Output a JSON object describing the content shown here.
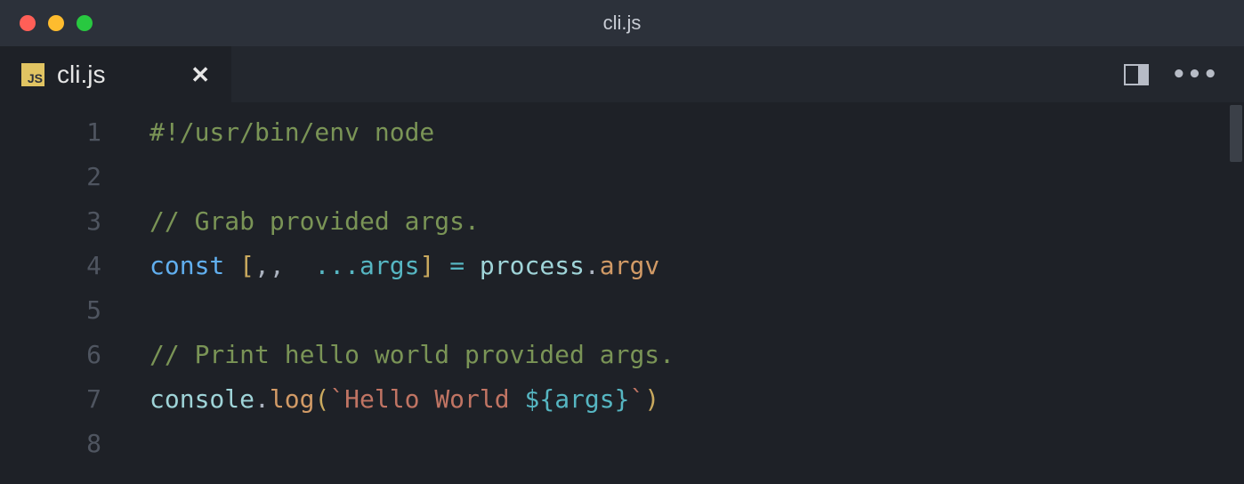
{
  "window": {
    "title": "cli.js"
  },
  "tabs": [
    {
      "icon": "js",
      "label": "cli.js",
      "dirty": false,
      "active": true
    }
  ],
  "editor": {
    "language": "javascript",
    "filename": "cli.js",
    "line_numbers": [
      "1",
      "2",
      "3",
      "4",
      "5",
      "6",
      "7",
      "8"
    ],
    "lines_plain": [
      "#!/usr/bin/env node",
      "",
      "// Grab provided args.",
      "const [,,  ...args] = process.argv",
      "",
      "// Print hello world provided args.",
      "console.log(`Hello World ${args}`)",
      ""
    ],
    "tokens": [
      [
        {
          "t": "#!/usr/bin/env node",
          "c": "tok-comment"
        }
      ],
      [
        {
          "t": " ",
          "c": "tok-ident"
        }
      ],
      [
        {
          "t": "// Grab provided args.",
          "c": "tok-comment"
        }
      ],
      [
        {
          "t": "const ",
          "c": "tok-keyword"
        },
        {
          "t": "[",
          "c": "tok-paren"
        },
        {
          "t": ",,  ",
          "c": "tok-punct"
        },
        {
          "t": "...",
          "c": "tok-op"
        },
        {
          "t": "args",
          "c": "tok-var"
        },
        {
          "t": "]",
          "c": "tok-paren"
        },
        {
          "t": " ",
          "c": "tok-punct"
        },
        {
          "t": "=",
          "c": "tok-op"
        },
        {
          "t": " ",
          "c": "tok-punct"
        },
        {
          "t": "process",
          "c": "tok-obj"
        },
        {
          "t": ".",
          "c": "tok-punct"
        },
        {
          "t": "argv",
          "c": "tok-prop"
        }
      ],
      [
        {
          "t": " ",
          "c": "tok-ident"
        }
      ],
      [
        {
          "t": "// Print hello world provided args.",
          "c": "tok-comment"
        }
      ],
      [
        {
          "t": "console",
          "c": "tok-obj"
        },
        {
          "t": ".",
          "c": "tok-punct"
        },
        {
          "t": "log",
          "c": "tok-prop"
        },
        {
          "t": "(",
          "c": "tok-paren"
        },
        {
          "t": "`Hello World ",
          "c": "tok-string"
        },
        {
          "t": "${",
          "c": "tok-interp"
        },
        {
          "t": "args",
          "c": "tok-var"
        },
        {
          "t": "}",
          "c": "tok-interp"
        },
        {
          "t": "`",
          "c": "tok-string"
        },
        {
          "t": ")",
          "c": "tok-paren"
        }
      ],
      [
        {
          "t": " ",
          "c": "tok-ident"
        }
      ]
    ]
  },
  "actions": {
    "split_label": "Split Editor",
    "more_label": "More Actions"
  }
}
